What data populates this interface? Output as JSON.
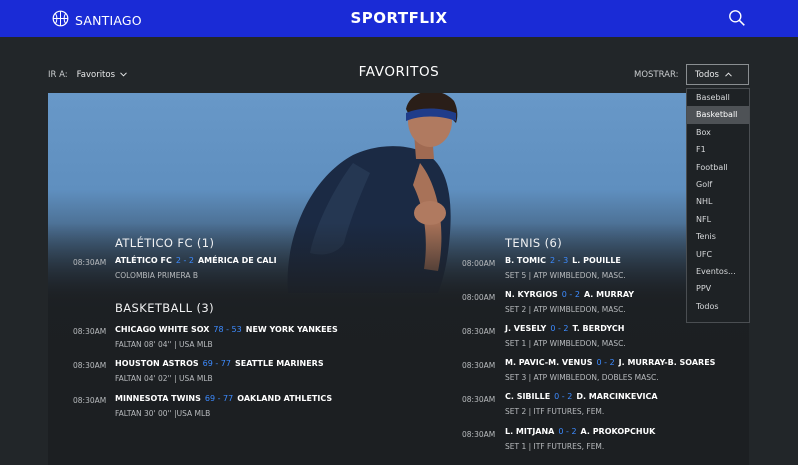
{
  "header": {
    "city": "SANTIAGO",
    "brand": "SPORTFLIX",
    "icons": {
      "city": "basketball-icon",
      "search": "search-icon"
    }
  },
  "subbar": {
    "goto_label": "IR A:",
    "goto_value": "Favoritos",
    "page_title": "FAVORITOS",
    "show_label": "MOSTRAR:",
    "show_value": "Todos"
  },
  "filter_menu": {
    "items": [
      "Baseball",
      "Basketball",
      "Box",
      "F1",
      "Football",
      "Golf",
      "NHL",
      "NFL",
      "Tenis",
      "UFC",
      "Eventos...",
      "PPV",
      "Todos"
    ],
    "highlighted": "Basketball"
  },
  "sections": {
    "atletico": {
      "title": "ATLÉTICO FC (1)",
      "events": [
        {
          "time": "08:30AM",
          "home": "ATLÉTICO FC",
          "score": "2 - 2",
          "away": "AMÉRICA DE CALI",
          "sub": "COLOMBIA PRIMERA B"
        }
      ]
    },
    "basketball": {
      "title": "BASKETBALL (3)",
      "events": [
        {
          "time": "08:30AM",
          "home": "CHICAGO WHITE SOX",
          "score": "78 - 53",
          "away": "NEW YORK YANKEES",
          "sub": "FALTAN 08' 04'' | USA MLB"
        },
        {
          "time": "08:30AM",
          "home": "HOUSTON ASTROS",
          "score": "69 - 77",
          "away": "SEATTLE MARINERS",
          "sub": "FALTAN 04' 02'' | USA MLB"
        },
        {
          "time": "08:30AM",
          "home": "MINNESOTA TWINS",
          "score": "69 - 77",
          "away": "OAKLAND ATHLETICS",
          "sub": "FALTAN 30' 00'' |USA MLB"
        }
      ]
    },
    "tenis": {
      "title": "TENIS (6)",
      "events": [
        {
          "time": "08:00AM",
          "home": "B. TOMIC",
          "score": "2 - 3",
          "away": "L. POUILLE",
          "sub": "SET 5 | ATP WIMBLEDON, MASC."
        },
        {
          "time": "08:00AM",
          "home": "N. KYRGIOS",
          "score": "0 - 2",
          "away": "A. MURRAY",
          "sub": "SET 2 | ATP WIMBLEDON, MASC."
        },
        {
          "time": "08:30AM",
          "home": "J. VESELY",
          "score": "0 - 2",
          "away": "T. BERDYCH",
          "sub": "SET 1 | ATP WIMBLEDON, MASC."
        },
        {
          "time": "08:30AM",
          "home": "M. PAVIC-M. VENUS",
          "score": "0 - 2",
          "away": "J. MURRAY-B. SOARES",
          "sub": "SET 3 | ATP WIMBLEDON, DOBLES MASC."
        },
        {
          "time": "08:30AM",
          "home": "C. SIBILLE",
          "score": "0 - 2",
          "away": "D. MARCINKEVICA",
          "sub": "SET 2 | ITF FUTURES, FEM."
        },
        {
          "time": "08:30AM",
          "home": "L. MITJANA",
          "score": "0 - 2",
          "away": "A. PROKOPCHUK",
          "sub": "SET 1 | ITF FUTURES, FEM."
        }
      ]
    }
  },
  "colors": {
    "header_bg": "#1a2bd6",
    "page_bg": "#222629",
    "score_accent": "#3d8bff",
    "menu_highlight": "#4e5256"
  }
}
